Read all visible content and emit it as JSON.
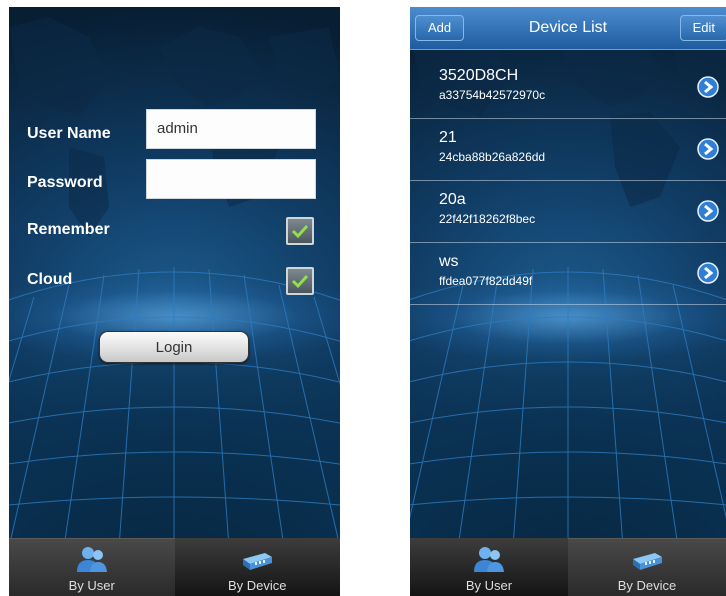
{
  "login_screen": {
    "username_label": "User Name",
    "username_value": "admin",
    "password_label": "Password",
    "password_value": "",
    "remember_label": "Remember",
    "remember_checked": true,
    "cloud_label": "Cloud",
    "cloud_checked": true,
    "login_button": "Login"
  },
  "device_screen": {
    "add_button": "Add",
    "title": "Device List",
    "edit_button": "Edit",
    "devices": [
      {
        "name": "3520D8CH",
        "id": "a33754b42572970c"
      },
      {
        "name": "21",
        "id": "24cba88b26a826dd"
      },
      {
        "name": "20a",
        "id": "22f42f18262f8bec"
      },
      {
        "name": "ws",
        "id": "ffdea077f82dd49f"
      }
    ]
  },
  "tabs": {
    "by_user": "By User",
    "by_device": "By Device"
  },
  "colors": {
    "header_blue": "#2f70b6",
    "background_blue": "#103c64",
    "check_green": "#7ed321"
  },
  "icons": [
    "users-icon",
    "device-icon",
    "checkmark-icon",
    "disclosure-arrow-icon"
  ]
}
